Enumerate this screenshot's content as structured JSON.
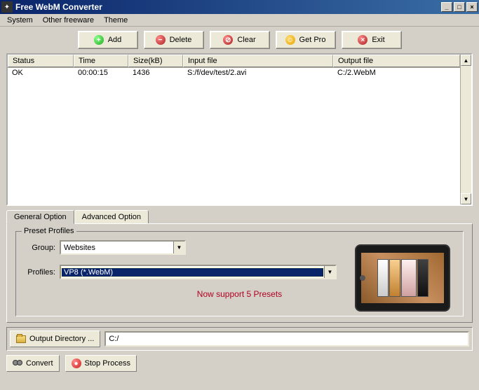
{
  "window": {
    "title": "Free WebM Converter"
  },
  "menu": {
    "system": "System",
    "otherFreeware": "Other freeware",
    "theme": "Theme"
  },
  "toolbar": {
    "add": "Add",
    "delete": "Delete",
    "clear": "Clear",
    "getpro": "Get Pro",
    "exit": "Exit"
  },
  "grid": {
    "columns": {
      "status": "Status",
      "time": "Time",
      "size": "Size(kB)",
      "input": "Input file",
      "output": "Output file"
    },
    "rows": [
      {
        "status": "OK",
        "time": "00:00:15",
        "size": "1436",
        "input": "S:/f/dev/test/2.avi",
        "output": "C:/2.WebM"
      }
    ]
  },
  "tabs": {
    "general": "General Option",
    "advanced": "Advanced Option"
  },
  "preset": {
    "legend": "Preset Profiles",
    "groupLabel": "Group:",
    "groupValue": "Websites",
    "profilesLabel": "Profiles:",
    "profilesValue": "VP8 (*.WebM)",
    "supportMsg": "Now support 5 Presets"
  },
  "bottom": {
    "outputDirBtn": "Output Directory ...",
    "outputDirValue": "C:/",
    "convert": "Convert",
    "stop": "Stop Process"
  }
}
